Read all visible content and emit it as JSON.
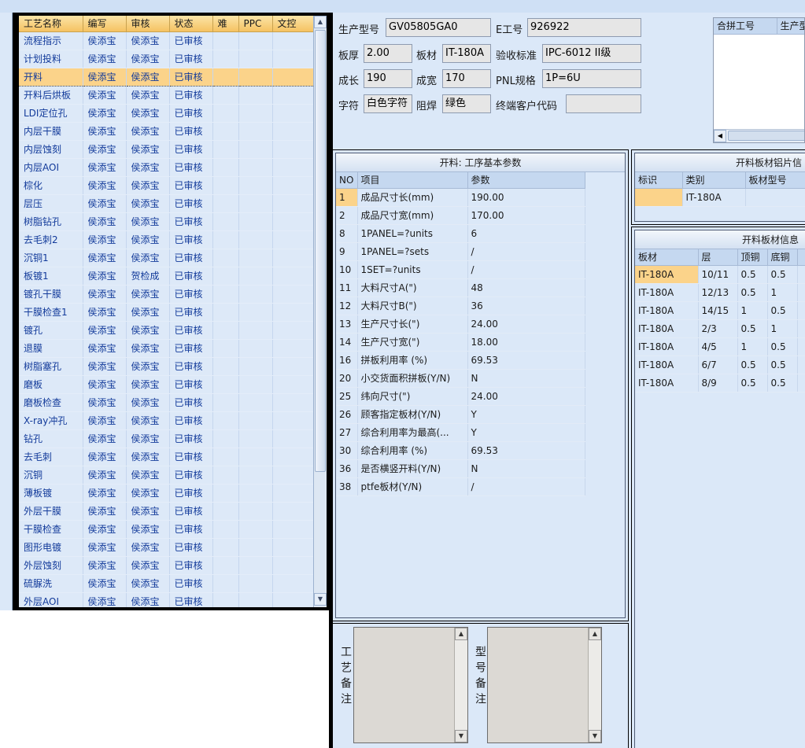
{
  "process_list": {
    "columns": [
      "工艺名称",
      "编写",
      "审核",
      "状态",
      "难",
      "PPC",
      "文控"
    ],
    "rows": [
      [
        "流程指示",
        "侯添宝",
        "侯添宝",
        "已审核"
      ],
      [
        "计划投料",
        "侯添宝",
        "侯添宝",
        "已审核"
      ],
      [
        "开料",
        "侯添宝",
        "侯添宝",
        "已审核"
      ],
      [
        "开料后烘板",
        "侯添宝",
        "侯添宝",
        "已审核"
      ],
      [
        "LDI定位孔",
        "侯添宝",
        "侯添宝",
        "已审核"
      ],
      [
        "内层干膜",
        "侯添宝",
        "侯添宝",
        "已审核"
      ],
      [
        "内层蚀刻",
        "侯添宝",
        "侯添宝",
        "已审核"
      ],
      [
        "内层AOI",
        "侯添宝",
        "侯添宝",
        "已审核"
      ],
      [
        "棕化",
        "侯添宝",
        "侯添宝",
        "已审核"
      ],
      [
        "层压",
        "侯添宝",
        "侯添宝",
        "已审核"
      ],
      [
        "树脂钻孔",
        "侯添宝",
        "侯添宝",
        "已审核"
      ],
      [
        "去毛刺2",
        "侯添宝",
        "侯添宝",
        "已审核"
      ],
      [
        "沉铜1",
        "侯添宝",
        "侯添宝",
        "已审核"
      ],
      [
        "板镀1",
        "侯添宝",
        "贺检成",
        "已审核"
      ],
      [
        "镀孔干膜",
        "侯添宝",
        "侯添宝",
        "已审核"
      ],
      [
        "干膜检查1",
        "侯添宝",
        "侯添宝",
        "已审核"
      ],
      [
        "镀孔",
        "侯添宝",
        "侯添宝",
        "已审核"
      ],
      [
        "退膜",
        "侯添宝",
        "侯添宝",
        "已审核"
      ],
      [
        "树脂塞孔",
        "侯添宝",
        "侯添宝",
        "已审核"
      ],
      [
        "磨板",
        "侯添宝",
        "侯添宝",
        "已审核"
      ],
      [
        "磨板检查",
        "侯添宝",
        "侯添宝",
        "已审核"
      ],
      [
        "X-ray冲孔",
        "侯添宝",
        "侯添宝",
        "已审核"
      ],
      [
        "钻孔",
        "侯添宝",
        "侯添宝",
        "已审核"
      ],
      [
        "去毛刺",
        "侯添宝",
        "侯添宝",
        "已审核"
      ],
      [
        "沉铜",
        "侯添宝",
        "侯添宝",
        "已审核"
      ],
      [
        "薄板镀",
        "侯添宝",
        "侯添宝",
        "已审核"
      ],
      [
        "外层干膜",
        "侯添宝",
        "侯添宝",
        "已审核"
      ],
      [
        "干膜检查",
        "侯添宝",
        "侯添宝",
        "已审核"
      ],
      [
        "图形电镀",
        "侯添宝",
        "侯添宝",
        "已审核"
      ],
      [
        "外层蚀刻",
        "侯添宝",
        "侯添宝",
        "已审核"
      ],
      [
        "硫脲洗",
        "侯添宝",
        "侯添宝",
        "已审核"
      ],
      [
        "外层AOI",
        "侯添宝",
        "侯添宝",
        "已审核"
      ]
    ],
    "selected_index": 2
  },
  "header": {
    "model_label": "生产型号",
    "model_value": "GV05805GA0",
    "e_label": "E工号",
    "e_value": "926922",
    "thickness_label": "板厚",
    "thickness_value": "2.00",
    "material_label": "板材",
    "material_value": "IT-180A",
    "standard_label": "验收标准",
    "standard_value": "IPC-6012 II级",
    "length_label": "成长",
    "length_value": "190",
    "width_label": "成宽",
    "width_value": "170",
    "pnl_label": "PNL规格",
    "pnl_value": "1P=6U",
    "char_label": "字符",
    "char_value": "白色字符",
    "mask_label": "阻焊",
    "mask_value": "绿色",
    "customer_label": "终端客户代码",
    "customer_value": ""
  },
  "merge_grid": {
    "columns": [
      "合拼工号",
      "生产型"
    ]
  },
  "params": {
    "title": "开料: 工序基本参数",
    "columns": [
      "NO",
      "项目",
      "参数"
    ],
    "rows": [
      [
        "1",
        "成品尺寸长(mm)",
        "190.00"
      ],
      [
        "2",
        "成品尺寸宽(mm)",
        "170.00"
      ],
      [
        "8",
        "1PANEL=?units",
        "6"
      ],
      [
        "9",
        "1PANEL=?sets",
        "/"
      ],
      [
        "10",
        "1SET=?units",
        "/"
      ],
      [
        "11",
        "大料尺寸A(\")",
        "48"
      ],
      [
        "12",
        "大料尺寸B(\")",
        "36"
      ],
      [
        "13",
        "生产尺寸长(\")",
        "24.00"
      ],
      [
        "14",
        "生产尺寸宽(\")",
        "18.00"
      ],
      [
        "16",
        "拼板利用率 (%)",
        "69.53"
      ],
      [
        "20",
        "小交货面积拼板(Y/N)",
        "N"
      ],
      [
        "25",
        "纬向尺寸(\")",
        "24.00"
      ],
      [
        "26",
        "顾客指定板材(Y/N)",
        "Y"
      ],
      [
        "27",
        "综合利用率为最高(...",
        "Y"
      ],
      [
        "30",
        "综合利用率 (%)",
        "69.53"
      ],
      [
        "36",
        "是否横竖开料(Y/N)",
        "N"
      ],
      [
        "38",
        "ptfe板材(Y/N)",
        "/"
      ]
    ]
  },
  "foil_panel": {
    "title": "开料板材铝片信",
    "columns": [
      "标识",
      "类别",
      "板材型号"
    ],
    "rows": [
      [
        "",
        "IT-180A",
        ""
      ]
    ]
  },
  "material_panel": {
    "title": "开料板材信息",
    "columns": [
      "板材",
      "层",
      "顶铜",
      "底铜"
    ],
    "rows": [
      [
        "IT-180A",
        "10/11",
        "0.5",
        "0.5"
      ],
      [
        "IT-180A",
        "12/13",
        "0.5",
        "1"
      ],
      [
        "IT-180A",
        "14/15",
        "1",
        "0.5"
      ],
      [
        "IT-180A",
        "2/3",
        "0.5",
        "1"
      ],
      [
        "IT-180A",
        "4/5",
        "1",
        "0.5"
      ],
      [
        "IT-180A",
        "6/7",
        "0.5",
        "0.5"
      ],
      [
        "IT-180A",
        "8/9",
        "0.5",
        "0.5"
      ]
    ]
  },
  "memo": {
    "process_label": "工艺备注",
    "model_label": "型号备注"
  },
  "colors": {
    "selection": "#fbd38a",
    "header_gold": "#f5c262",
    "panel_bg": "#dbe8f8",
    "link_text": "#123a9a"
  }
}
